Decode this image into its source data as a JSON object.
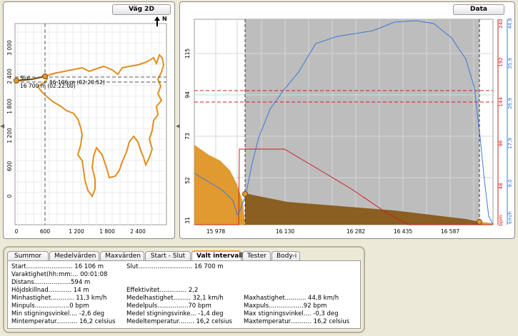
{
  "left_panel": {
    "title": "Väg 2D",
    "north": "N",
    "x_ticks": [
      "0",
      "600",
      "1 200",
      "1 800",
      "2 400"
    ],
    "y_ticks": [
      "3 000",
      "2 400",
      "1 800",
      "1 200",
      "600",
      "0"
    ],
    "labels": {
      "slut": "Slut",
      "start_dist": "16 106 m (02:20:52)",
      "end_dist": "16 700 m (02:22:00)"
    }
  },
  "right_panel": {
    "title": "Data",
    "x_ticks": [
      "15 978",
      "16 130",
      "16 282",
      "16 435",
      "16 587"
    ],
    "left_y_ticks": [
      "115",
      "94",
      "73",
      "52",
      "31"
    ],
    "bpm_ticks": [
      "240",
      "192",
      "144",
      "96",
      "48"
    ],
    "bpm_unit": "bpm",
    "kmh_ticks": [
      "44,8",
      "35,9",
      "26,9",
      "17,9",
      "9,0"
    ],
    "kmh_unit": "km/h",
    "colors": {
      "altitude": "#e09a30",
      "altitude_dark": "#8b5e22",
      "speed": "#3a78d8",
      "pulse": "#cc2020",
      "selection": "#bdbdbd"
    }
  },
  "tabs": [
    {
      "label": "Summor",
      "active": false
    },
    {
      "label": "Medelvärden",
      "active": false
    },
    {
      "label": "Maxvärden",
      "active": false
    },
    {
      "label": "Start - Slut",
      "active": false
    },
    {
      "label": "Valt intervall",
      "active": true
    },
    {
      "label": "Tester",
      "active": false
    },
    {
      "label": "Body-i",
      "active": false
    }
  ],
  "stats": {
    "start": "Start........................ 16 106 m",
    "slut": "Slut............................ 16 700 m",
    "varaktighet": "Varaktighet(hh:mm:... 00:01:08",
    "distans": "Distans...................594 m",
    "hojdskillnad": "Höjdskillnad............ 14 m",
    "effektivitet": "Effektivitet.............. 2,2",
    "minhastighet": "Minhastighet............ 11,3 km/h",
    "medelhastighet": "Medelhastighet......... 32,1 km/h",
    "maxhastighet": "Maxhastighet........... 44,8 km/h",
    "minpuls": "Minpuls..................0 bpm",
    "medelpuls": "Medelpuls................70 bpm",
    "maxpuls": "Maxpuls..................92 bpm",
    "min_stigning": "Min stigningsvinkel.... -2,6 deg",
    "medel_stigning": "Medel stigningsvinke... -1,4 deg",
    "max_stigning": "Max stigningsvinkel.... -0,3 deg",
    "mintemp": "Mintemperatur........... 16,2 celsius",
    "medeltemp": "Medeltemperatur........ 16,2 celsius",
    "maxtemp": "Maxtemperatur........... 16,2 celsius"
  }
}
